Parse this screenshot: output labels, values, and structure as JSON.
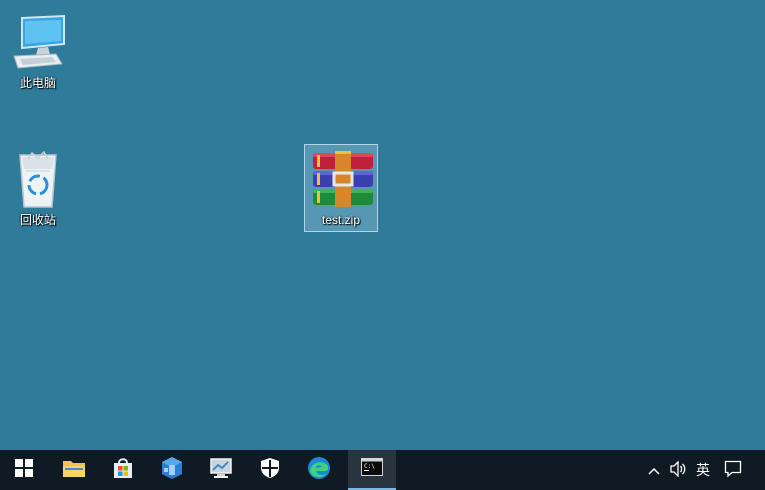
{
  "desktop": {
    "background": "#2e7b9a",
    "icons": [
      {
        "label": "此电脑",
        "icon": "this-pc-icon"
      },
      {
        "label": "回收站",
        "icon": "recycle-bin-icon"
      },
      {
        "label": "test.zip",
        "icon": "winrar-archive-icon",
        "selected": true
      }
    ]
  },
  "taskbar": {
    "background": "#101a24",
    "items": [
      {
        "icon": "windows-start-icon"
      },
      {
        "icon": "file-explorer-icon"
      },
      {
        "icon": "microsoft-store-icon"
      },
      {
        "icon": "app-icon"
      },
      {
        "icon": "remote-desktop-icon"
      },
      {
        "icon": "windows-security-icon"
      },
      {
        "icon": "edge-icon"
      },
      {
        "icon": "terminal-icon",
        "active": true
      }
    ],
    "tray": {
      "show_hidden_icon": "chevron-up-icon",
      "volume_icon": "speaker-icon",
      "language": "英",
      "notifications_icon": "action-center-icon"
    }
  }
}
